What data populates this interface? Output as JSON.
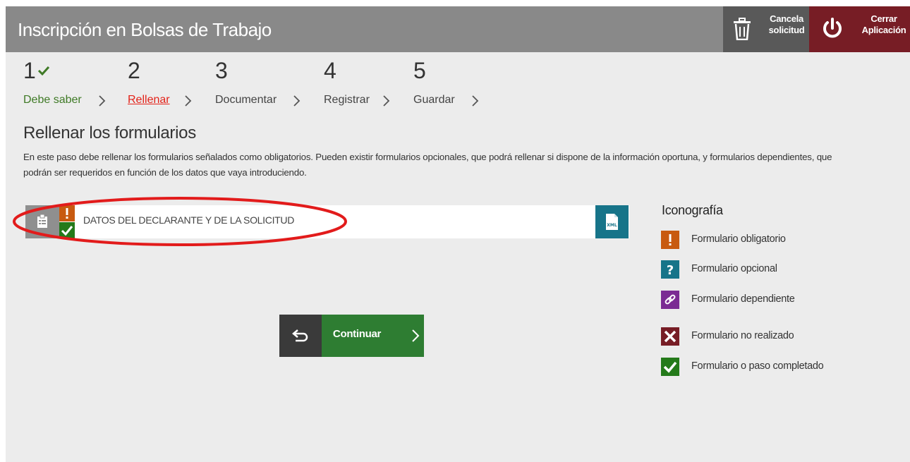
{
  "header": {
    "title": "Inscripción en Bolsas de Trabajo",
    "cancel_line1": "Cancela",
    "cancel_line2": "solicitud",
    "close_line1": "Cerrar",
    "close_line2": "Aplicación",
    "cancel_icon": "trash-icon",
    "close_icon": "power-icon"
  },
  "steps": [
    {
      "number": "1",
      "label": "Debe saber",
      "state": "completed"
    },
    {
      "number": "2",
      "label": "Rellenar",
      "state": "active"
    },
    {
      "number": "3",
      "label": "Documentar",
      "state": "pending"
    },
    {
      "number": "4",
      "label": "Registrar",
      "state": "pending"
    },
    {
      "number": "5",
      "label": "Guardar",
      "state": "pending"
    }
  ],
  "section": {
    "title": "Rellenar los formularios",
    "description": "En este paso debe rellenar los formularios señalados como obligatorios. Pueden existir formularios opcionales, que podrá rellenar si dispone de la información oportuna, y formularios dependientes, que podrán ser requeridos en función de los datos que vaya introduciendo."
  },
  "forms": [
    {
      "name": "DATOS DEL DECLARANTE Y DE LA SOLICITUD",
      "badges": [
        "obligatorio",
        "completado"
      ],
      "xml_label": "XML"
    }
  ],
  "legend": {
    "title": "Iconografía",
    "items": [
      {
        "label": "Formulario obligatorio",
        "symbol": "!",
        "color": "#c85a10"
      },
      {
        "label": "Formulario opcional",
        "symbol": "?",
        "color": "#177489"
      },
      {
        "label": "Formulario dependiente",
        "symbol": "link",
        "color": "#7b2b93"
      },
      {
        "label": "Formulario no realizado",
        "symbol": "x",
        "color": "#771d25"
      },
      {
        "label": "Formulario o paso completado",
        "symbol": "check",
        "color": "#247a1a"
      }
    ]
  },
  "actions": {
    "continue_label": "Continuar",
    "back_icon": "return-arrow-icon"
  },
  "colors": {
    "header_bg": "#898989",
    "close_bg": "#771d25",
    "active_step": "#e32219",
    "completed": "#3f7a26",
    "continue_bg": "#2e7d32",
    "highlight_ring": "#e21b1b"
  }
}
